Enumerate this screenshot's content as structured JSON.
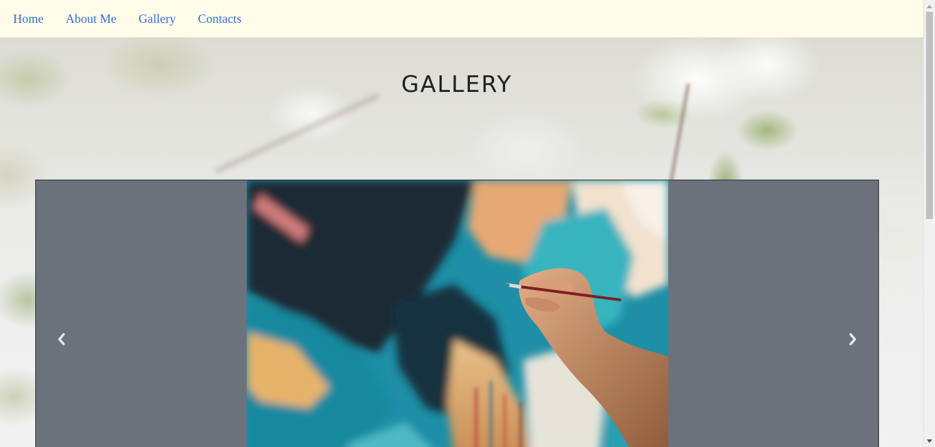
{
  "nav": {
    "items": [
      {
        "label": "Home"
      },
      {
        "label": "About Me"
      },
      {
        "label": "Gallery"
      },
      {
        "label": "Contacts"
      }
    ]
  },
  "page": {
    "title": "GALLERY"
  },
  "carousel": {
    "prev_icon": "chevron-left-icon",
    "next_icon": "chevron-right-icon",
    "slide_image": "painting-hand-brush"
  },
  "colors": {
    "navbar_bg": "#fffcea",
    "nav_link": "#2f6fd6",
    "carousel_bg": "#6c727c"
  }
}
